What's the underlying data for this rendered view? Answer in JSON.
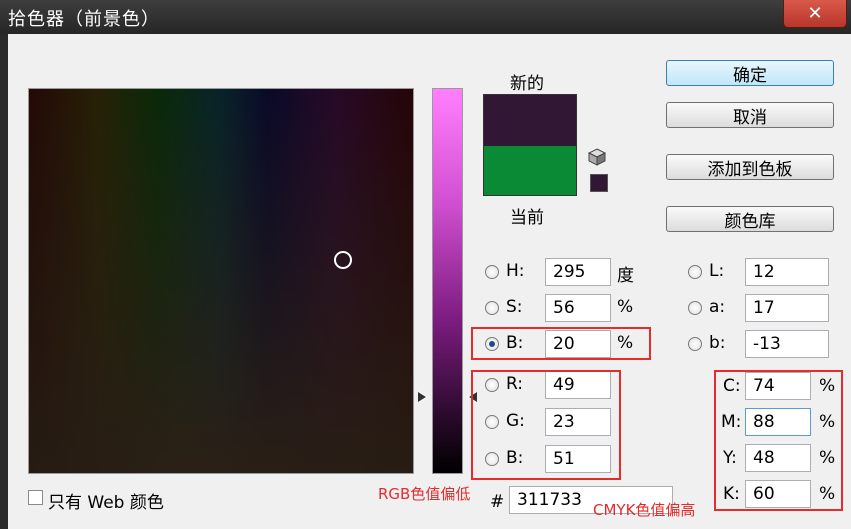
{
  "window": {
    "title": "拾色器（前景色）",
    "close_glyph": "✕"
  },
  "labels": {
    "new": "新的",
    "current": "当前"
  },
  "colors": {
    "new": "#311733",
    "current": "#0a8a34"
  },
  "buttons": {
    "ok": "确定",
    "cancel": "取消",
    "add_swatch": "添加到色板",
    "libraries": "颜色库"
  },
  "hsb": {
    "h": {
      "label": "H:",
      "value": "295",
      "unit": "度"
    },
    "s": {
      "label": "S:",
      "value": "56",
      "unit": "%"
    },
    "b": {
      "label": "B:",
      "value": "20",
      "unit": "%"
    }
  },
  "rgb": {
    "r": {
      "label": "R:",
      "value": "49"
    },
    "g": {
      "label": "G:",
      "value": "23"
    },
    "b": {
      "label": "B:",
      "value": "51"
    }
  },
  "lab": {
    "l": {
      "label": "L:",
      "value": "12"
    },
    "a": {
      "label": "a:",
      "value": "17"
    },
    "b": {
      "label": "b:",
      "value": "-13"
    }
  },
  "cmyk": {
    "c": {
      "label": "C:",
      "value": "74",
      "unit": "%"
    },
    "m": {
      "label": "M:",
      "value": "88",
      "unit": "%"
    },
    "y": {
      "label": "Y:",
      "value": "48",
      "unit": "%"
    },
    "k": {
      "label": "K:",
      "value": "60",
      "unit": "%"
    }
  },
  "hex": {
    "label": "#",
    "value": "311733"
  },
  "web_only": {
    "label": "只有 Web 颜色"
  },
  "annotations": {
    "rgb_note": "RGB色值偏低",
    "cmyk_note": "CMYK色值偏高"
  },
  "icons": {
    "cube": "cube-icon",
    "close": "close-icon"
  }
}
